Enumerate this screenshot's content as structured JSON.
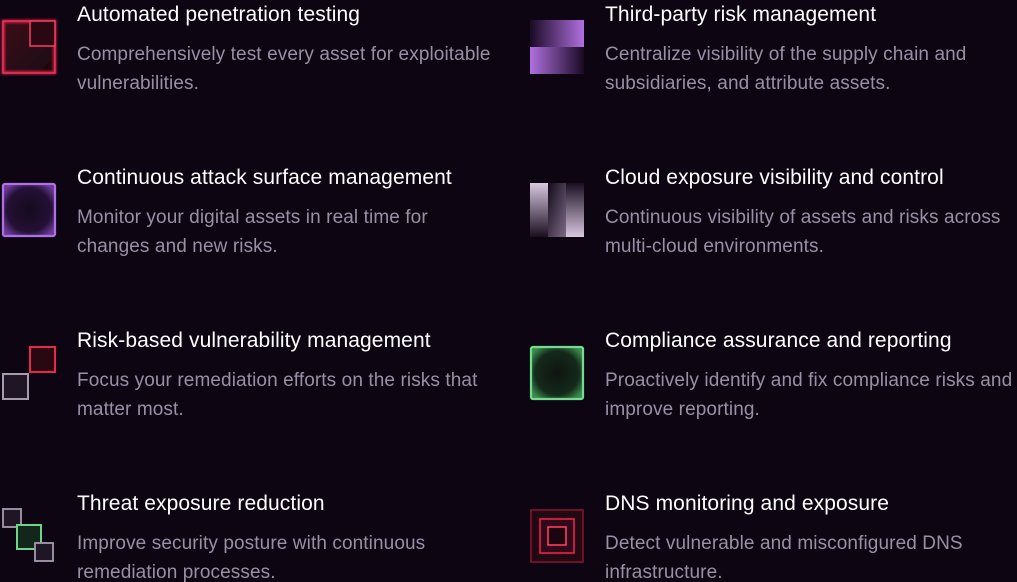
{
  "features": [
    {
      "title": "Automated penetration testing",
      "description": "Comprehensively test every asset for exploitable vulnerabilities.",
      "icon": "pentest-squares-icon",
      "accent": "#e0224a"
    },
    {
      "title": "Third-party risk management",
      "description": "Centralize visibility of the supply chain and subsidiaries, and attribute assets.",
      "icon": "third-party-blocks-icon",
      "accent": "#b078e0"
    },
    {
      "title": "Continuous attack surface management",
      "description": "Monitor your digital assets in real time for changes and new risks.",
      "icon": "attack-surface-square-icon",
      "accent": "#a868e0"
    },
    {
      "title": "Cloud exposure visibility and control",
      "description": "Continuous visibility of assets and risks across multi-cloud environments.",
      "icon": "cloud-exposure-blocks-icon",
      "accent": "#c8b8d0"
    },
    {
      "title": "Risk-based vulnerability management",
      "description": "Focus your remediation efforts on the risks that matter most.",
      "icon": "vulnerability-squares-icon",
      "accent": "#e0224a"
    },
    {
      "title": "Compliance assurance and reporting",
      "description": "Proactively identify and fix compliance risks and improve reporting.",
      "icon": "compliance-square-icon",
      "accent": "#6ed48a"
    },
    {
      "title": "Threat exposure reduction",
      "description": "Improve security posture with continuous remediation processes.",
      "icon": "threat-reduction-squares-icon",
      "accent": "#6ed48a"
    },
    {
      "title": "DNS monitoring and exposure",
      "description": "Detect vulnerable and misconfigured DNS infrastructure.",
      "icon": "dns-nested-squares-icon",
      "accent": "#e0224a"
    }
  ]
}
